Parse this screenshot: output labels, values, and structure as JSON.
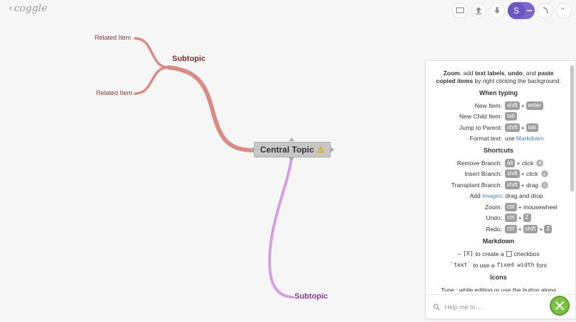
{
  "app": {
    "logo_text": "coggle"
  },
  "toolbar": {
    "avatar_letter": "S",
    "buttons": [
      "present-icon",
      "share-icon",
      "download-icon",
      "history-icon",
      "quote-icon"
    ]
  },
  "map": {
    "central": "Central Topic",
    "warning_glyph": "⚠",
    "subtopic_top": "Subtopic",
    "subtopic_bottom": "Subtopic",
    "related_1": "Related Item",
    "related_2": "Related Item",
    "colors": {
      "upper_branch": "#d98c86",
      "lower_branch": "#d99de8"
    }
  },
  "help": {
    "intro": {
      "zoom": "Zoom",
      "t1": ", add ",
      "labels": "text labels",
      "t2": ", ",
      "undo": "undo",
      "t3": ", and ",
      "paste": "paste copied items",
      "t4": " by right clicking the background."
    },
    "when_typing": {
      "heading": "When typing",
      "new_item": "New Item:",
      "new_item_k1": "shift",
      "new_item_k2": "enter",
      "new_child": "New Child Item:",
      "new_child_k": "tab",
      "jump": "Jump to Parent:",
      "jump_k1": "shift",
      "jump_k2": "tab",
      "format": "Format text:",
      "format_use": "use",
      "format_link": "Markdown"
    },
    "shortcuts": {
      "heading": "Shortcuts",
      "remove": "Remove Branch:",
      "remove_k": "alt",
      "remove_t": "+ click",
      "insert": "Insert Branch:",
      "insert_k": "shift",
      "insert_t": "+ click",
      "transplant": "Transplant Branch:",
      "transplant_k": "shift",
      "transplant_t": "+ drag",
      "add": "Add",
      "add_link": "Images",
      "add_t": ": drag and drop",
      "zoom": "Zoom:",
      "zoom_k": "ctrl",
      "zoom_t": "+ mousewheel",
      "undo": "Undo:",
      "undo_k1": "ctrl",
      "undo_k2": "Z",
      "redo": "Redo:",
      "redo_k1": "ctrl",
      "redo_k2": "shift",
      "redo_k3": "Z"
    },
    "markdown": {
      "heading": "Markdown",
      "c1a": "–",
      "c1code": "[X]",
      "c1b": "to create a",
      "c1c": "checkbox",
      "c2code": "`text`",
      "c2b": "to use a",
      "c2code2": "fixed width",
      "c2c": "font"
    },
    "icons": {
      "heading": "Icons",
      "text": "Type : while editing or use the button along"
    },
    "search_placeholder": "Help me to..."
  }
}
